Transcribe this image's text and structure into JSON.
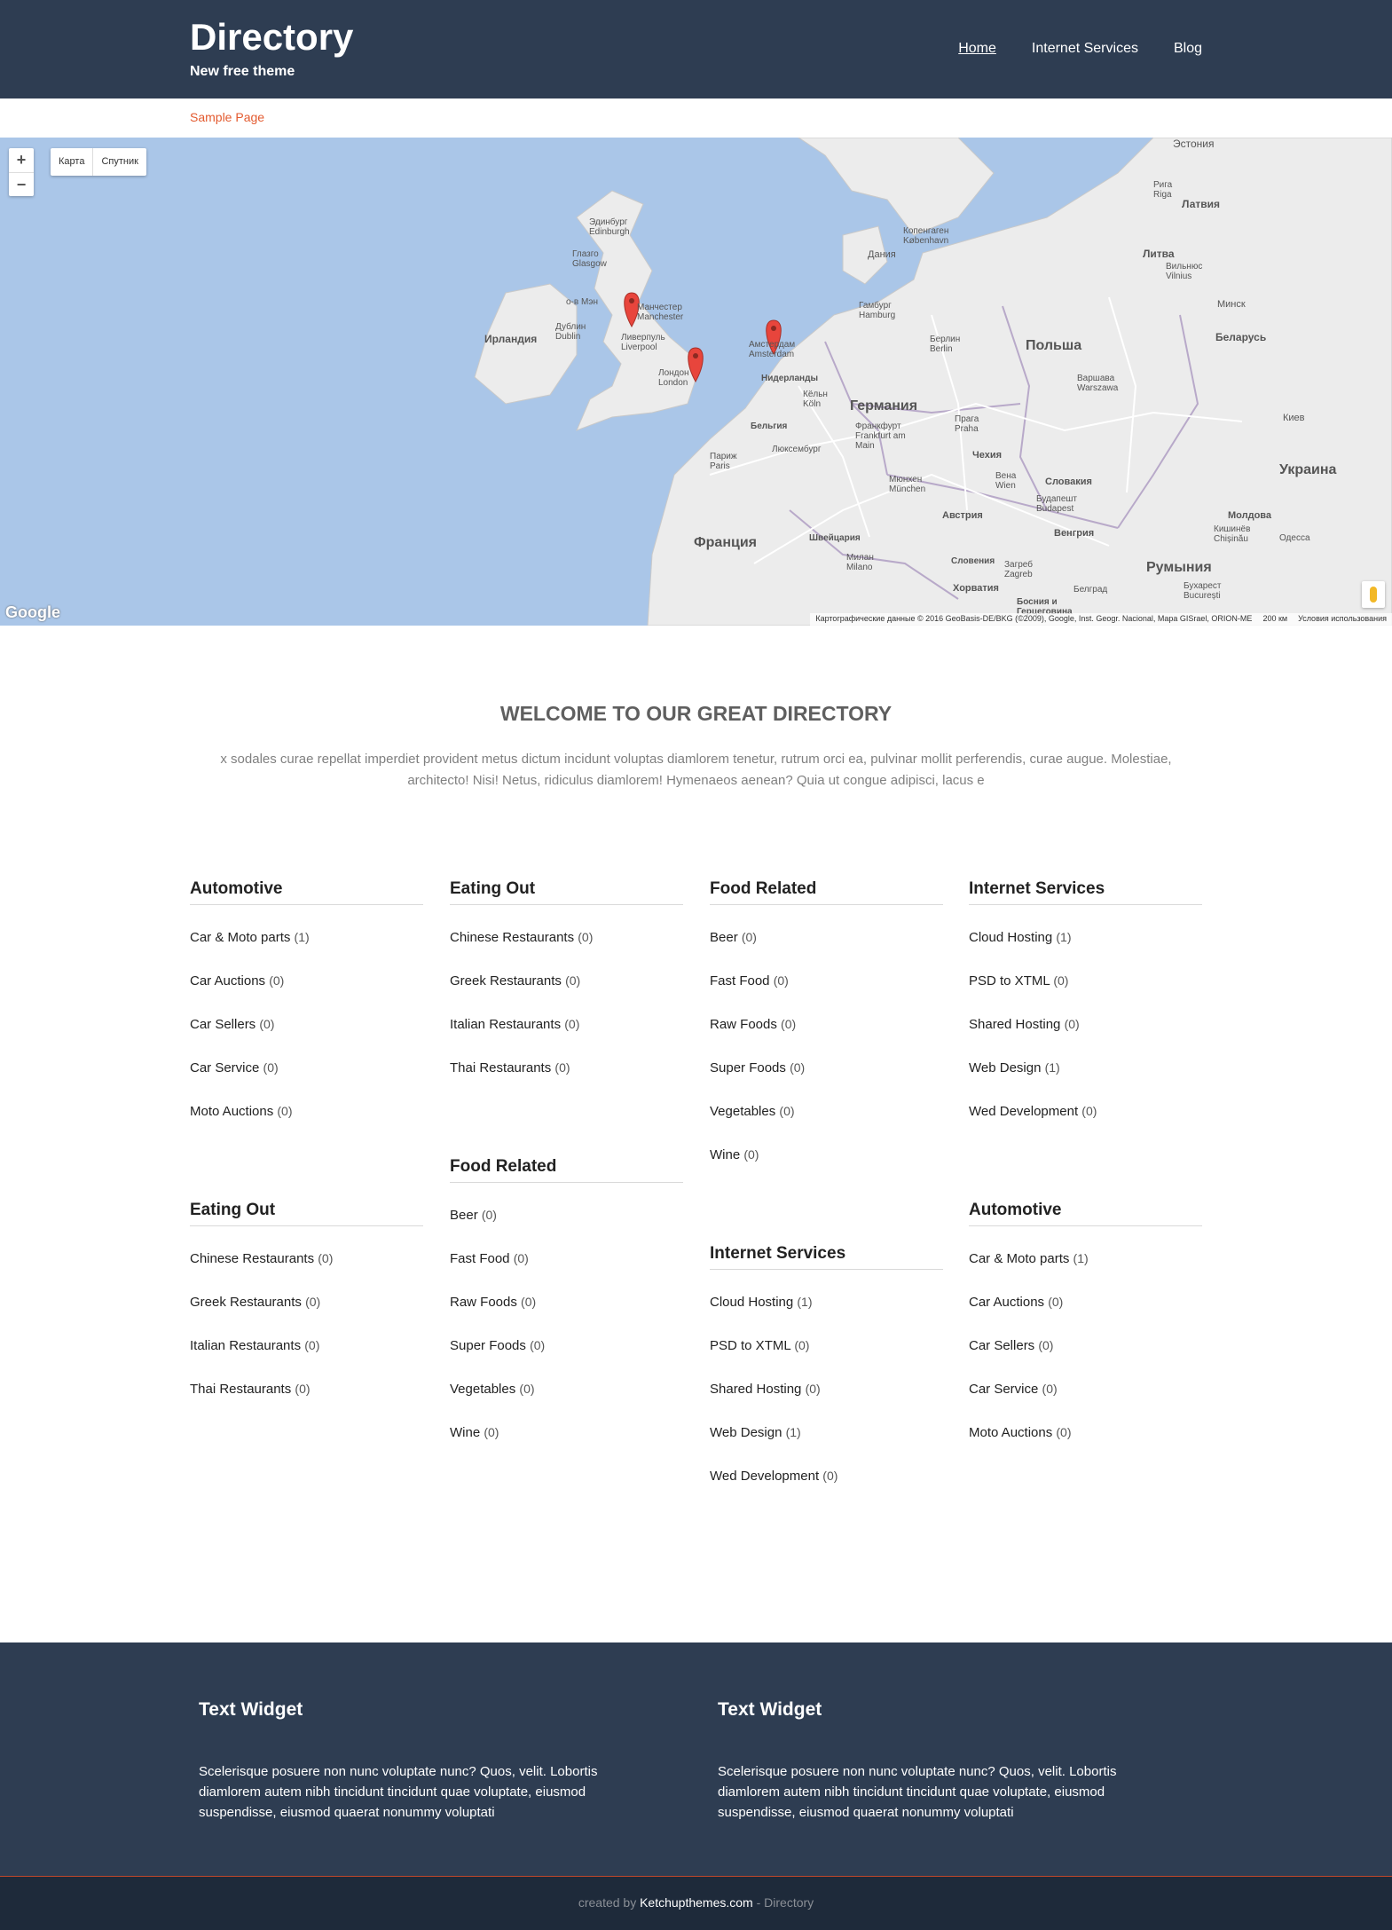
{
  "header": {
    "title": "Directory",
    "tagline": "New free theme",
    "nav": [
      {
        "label": "Home"
      },
      {
        "label": "Internet Services"
      },
      {
        "label": "Blog"
      }
    ]
  },
  "subnav": {
    "link": "Sample Page"
  },
  "map": {
    "zoom_in": "+",
    "zoom_out": "−",
    "type_map": "Карта",
    "type_satellite": "Спутник",
    "google": "Google",
    "attribution": "Картографические данные © 2016 GeoBasis-DE/BKG (©2009), Google, Inst. Geogr. Nacional, Mapa GISrael, ORION-ME",
    "scale": "200 км",
    "terms": "Условия использования",
    "labels": [
      "Эстония",
      "Рига Riga",
      "Латвия",
      "Копенгаген København",
      "Дания",
      "Литва",
      "Вильнюс Vilnius",
      "Эдинбург Edinburgh",
      "Глазго Glasgow",
      "о-в Мэн",
      "Ирландия",
      "Дублин Dublin",
      "Манчестер Manchester",
      "Ливерпуль Liverpool",
      "Лондон London",
      "Амстердам Amsterdam",
      "Нидерланды",
      "Гамбург Hamburg",
      "Берлин Berlin",
      "Польша",
      "Варшава Warszawa",
      "Минск",
      "Беларусь",
      "Германия",
      "Бельгия",
      "Кёльн Köln",
      "Франкфурт Frankfurt am Main",
      "Прага Praha",
      "Чехия",
      "Киев",
      "Украина",
      "Париж Paris",
      "Люксембург",
      "Мюнхен München",
      "Вена Wien",
      "Словакия",
      "Будапешт Budapest",
      "Австрия",
      "Венгрия",
      "Молдова",
      "Кишинёв Chișinău",
      "Одесса",
      "Франция",
      "Швейцария",
      "Милан Milano",
      "Словения",
      "Загреб Zagreb",
      "Хорватия",
      "Румыния",
      "Бухарест București",
      "Белград",
      "Босния и Герцеговина"
    ]
  },
  "welcome": {
    "title": "WELCOME TO OUR GREAT DIRECTORY",
    "text": "x sodales curae repellat imperdiet provident metus dictum incidunt voluptas diamlorem tenetur, rutrum orci ea, pulvinar mollit perferendis, curae augue. Molestiae, architecto! Nisi! Netus, ridiculus diamlorem! Hymenaeos aenean? Quia ut congue adipisci, lacus e"
  },
  "categories": [
    {
      "title": "Automotive",
      "items": [
        {
          "name": "Car & Moto parts",
          "count": "(1)"
        },
        {
          "name": "Car Auctions",
          "count": "(0)"
        },
        {
          "name": "Car Sellers",
          "count": "(0)"
        },
        {
          "name": "Car Service",
          "count": "(0)"
        },
        {
          "name": "Moto Auctions",
          "count": "(0)"
        }
      ]
    },
    {
      "title": "Eating Out",
      "items": [
        {
          "name": "Chinese Restaurants",
          "count": "(0)"
        },
        {
          "name": "Greek Restaurants",
          "count": "(0)"
        },
        {
          "name": "Italian Restaurants",
          "count": "(0)"
        },
        {
          "name": "Thai Restaurants",
          "count": "(0)"
        }
      ]
    },
    {
      "title": "Food Related",
      "items": [
        {
          "name": "Beer",
          "count": "(0)"
        },
        {
          "name": "Fast Food",
          "count": "(0)"
        },
        {
          "name": "Raw Foods",
          "count": "(0)"
        },
        {
          "name": "Super Foods",
          "count": "(0)"
        },
        {
          "name": "Vegetables",
          "count": "(0)"
        },
        {
          "name": "Wine",
          "count": "(0)"
        }
      ]
    },
    {
      "title": "Internet Services",
      "items": [
        {
          "name": "Cloud Hosting",
          "count": "(1)"
        },
        {
          "name": "PSD to XTML",
          "count": "(0)"
        },
        {
          "name": "Shared Hosting",
          "count": "(0)"
        },
        {
          "name": "Web Design",
          "count": "(1)"
        },
        {
          "name": "Wed Development",
          "count": "(0)"
        }
      ]
    },
    {
      "title": "Eating Out",
      "items": [
        {
          "name": "Chinese Restaurants",
          "count": "(0)"
        },
        {
          "name": "Greek Restaurants",
          "count": "(0)"
        },
        {
          "name": "Italian Restaurants",
          "count": "(0)"
        },
        {
          "name": "Thai Restaurants",
          "count": "(0)"
        }
      ]
    },
    {
      "title": "Food Related",
      "items": [
        {
          "name": "Beer",
          "count": "(0)"
        },
        {
          "name": "Fast Food",
          "count": "(0)"
        },
        {
          "name": "Raw Foods",
          "count": "(0)"
        },
        {
          "name": "Super Foods",
          "count": "(0)"
        },
        {
          "name": "Vegetables",
          "count": "(0)"
        },
        {
          "name": "Wine",
          "count": "(0)"
        }
      ]
    },
    {
      "title": "Internet Services",
      "items": [
        {
          "name": "Cloud Hosting",
          "count": "(1)"
        },
        {
          "name": "PSD to XTML",
          "count": "(0)"
        },
        {
          "name": "Shared Hosting",
          "count": "(0)"
        },
        {
          "name": "Web Design",
          "count": "(1)"
        },
        {
          "name": "Wed Development",
          "count": "(0)"
        }
      ]
    },
    {
      "title": "Automotive",
      "items": [
        {
          "name": "Car & Moto parts",
          "count": "(1)"
        },
        {
          "name": "Car Auctions",
          "count": "(0)"
        },
        {
          "name": "Car Sellers",
          "count": "(0)"
        },
        {
          "name": "Car Service",
          "count": "(0)"
        },
        {
          "name": "Moto Auctions",
          "count": "(0)"
        }
      ]
    }
  ],
  "footer": {
    "widgets": [
      {
        "title": "Text Widget",
        "text": "Scelerisque posuere non nunc voluptate nunc? Quos, velit. Lobortis diamlorem autem nibh tincidunt tincidunt quae voluptate, eiusmod suspendisse, eiusmod quaerat nonummy voluptati"
      },
      {
        "title": "Text Widget",
        "text": "Scelerisque posuere non nunc voluptate nunc? Quos, velit. Lobortis diamlorem autem nibh tincidunt tincidunt quae voluptate, eiusmod suspendisse, eiusmod quaerat nonummy voluptati"
      }
    ],
    "credits_prefix": "created by",
    "credits_link": "Ketchupthemes.com",
    "credits_suffix": "- Directory"
  },
  "colors": {
    "header_bg": "#2e3d52",
    "accent": "#e35a2f",
    "water": "#aac6e8",
    "land": "#ececec",
    "marker": "#e8453c"
  }
}
